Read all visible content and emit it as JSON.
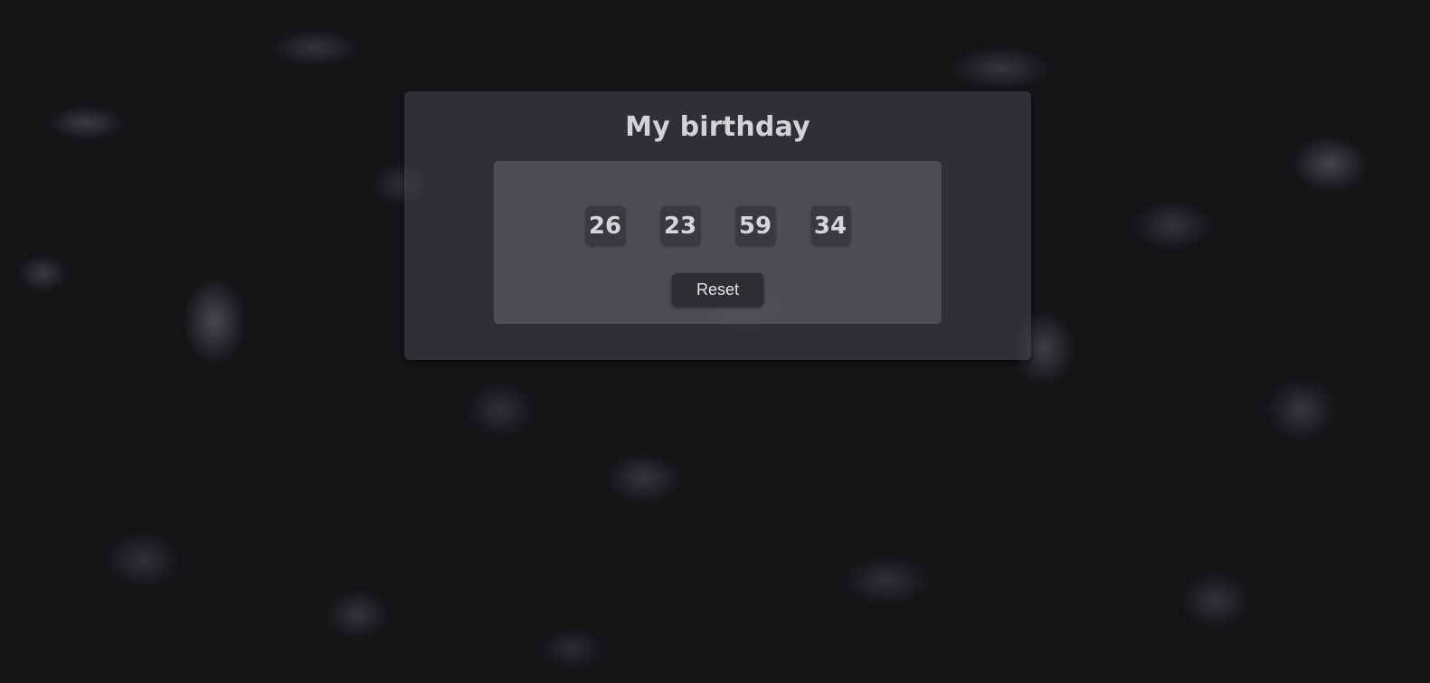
{
  "page": {
    "title": "My birthday"
  },
  "countdown": {
    "values": [
      "26",
      "23",
      "59",
      "34"
    ]
  },
  "actions": {
    "reset_label": "Reset"
  },
  "colors": {
    "background": "#141417",
    "card": "#46464e",
    "counter_box": "#3a393f",
    "button": "#2e2d33",
    "text": "#d3d3d6"
  }
}
